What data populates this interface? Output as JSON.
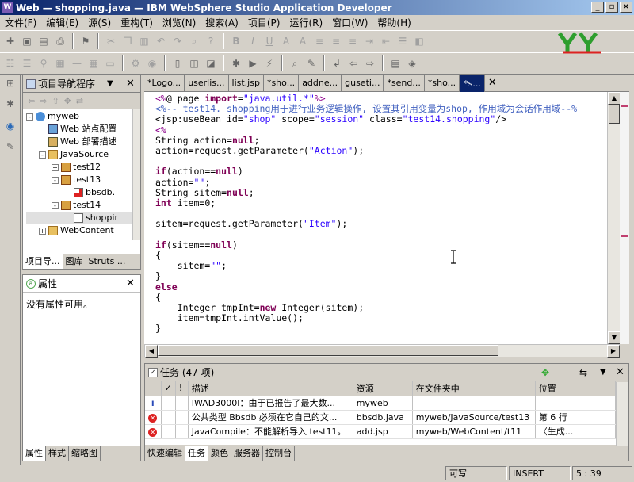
{
  "window": {
    "title": "Web — shopping.java — IBM WebSphere Studio Application Developer",
    "btn_min": "_",
    "btn_max": "▫",
    "btn_close": "×"
  },
  "menu": [
    "文件(F)",
    "编辑(E)",
    "源(S)",
    "重构(T)",
    "浏览(N)",
    "搜索(A)",
    "项目(P)",
    "运行(R)",
    "窗口(W)",
    "帮助(H)"
  ],
  "navigator": {
    "title": "项目导航程序",
    "tree": [
      {
        "label": "myweb",
        "indent": 0,
        "icon": "web-project-icon",
        "pm": "-"
      },
      {
        "label": "Web 站点配置",
        "indent": 1,
        "icon": "site-config-icon",
        "pm": ""
      },
      {
        "label": "Web 部署描述",
        "indent": 1,
        "icon": "deploy-descriptor-icon",
        "pm": ""
      },
      {
        "label": "JavaSource",
        "indent": 1,
        "icon": "folder-icon",
        "pm": "-"
      },
      {
        "label": "test12",
        "indent": 2,
        "icon": "package-icon",
        "pm": "+"
      },
      {
        "label": "test13",
        "indent": 2,
        "icon": "package-icon",
        "pm": "-"
      },
      {
        "label": "bbsdb.",
        "indent": 3,
        "icon": "java-error-icon",
        "pm": ""
      },
      {
        "label": "test14",
        "indent": 2,
        "icon": "package-icon",
        "pm": "-"
      },
      {
        "label": "shoppir",
        "indent": 3,
        "icon": "java-file-icon",
        "pm": ""
      },
      {
        "label": "WebContent",
        "indent": 1,
        "icon": "folder-icon",
        "pm": "+"
      }
    ],
    "tabs": [
      "项目导...",
      "图库",
      "Struts ..."
    ]
  },
  "properties": {
    "title": "属性",
    "empty": "没有属性可用。",
    "tabs": [
      "属性",
      "样式",
      "缩略图"
    ]
  },
  "editor": {
    "tabs": [
      "*Logo...",
      "userlis...",
      "list.jsp",
      "*sho...",
      "addne...",
      "guseti...",
      "*send...",
      "*sho...",
      "*s..."
    ],
    "code": [
      "<%@ page import=\"java.util.*\"%>",
      "<%-- test14. shopping用于进行业务逻辑操作, 设置其引用变量为shop, 作用域为会话作用域--%",
      "<jsp:useBean id=\"shop\" scope=\"session\" class=\"test14.shopping\"/>",
      "<%",
      "String action=null;",
      "action=request.getParameter(\"Action\");",
      "",
      "if(action==null)",
      "action=\"\";",
      "String sitem=null;",
      "int item=0;",
      "",
      "sitem=request.getParameter(\"Item\");",
      "",
      "if(sitem==null)",
      "{",
      "    sitem=\"\";",
      "}",
      "else",
      "{",
      "    Integer tmpInt=new Integer(sitem);",
      "    item=tmpInt.intValue();",
      "}"
    ]
  },
  "tasks": {
    "title": "任务 (47 项)",
    "columns": [
      "",
      "✓",
      "!",
      "描述",
      "资源",
      "在文件夹中",
      "位置"
    ],
    "rows": [
      {
        "kind": "info",
        "desc": "IWAD3000I：由于已报告了最大数...",
        "res": "myweb",
        "folder": "",
        "loc": ""
      },
      {
        "kind": "error",
        "desc": "公共类型 Bbsdb 必须在它自己的文...",
        "res": "bbsdb.java",
        "folder": "myweb/JavaSource/test13",
        "loc": "第 6 行"
      },
      {
        "kind": "error",
        "desc": "JavaCompile：不能解析导入 test11。",
        "res": "add.jsp",
        "folder": "myweb/WebContent/t11",
        "loc": "〈生成..."
      }
    ],
    "tabs": [
      "快速编辑",
      "任务",
      "颜色",
      "服务器",
      "控制台"
    ]
  },
  "status": {
    "writable": "可写",
    "mode": "INSERT",
    "position": "5 : 39"
  },
  "colors": {
    "keyword": "#7f0055",
    "string": "#2a00ff",
    "comment": "#3f5fbf",
    "jsp": "#8b008b"
  }
}
